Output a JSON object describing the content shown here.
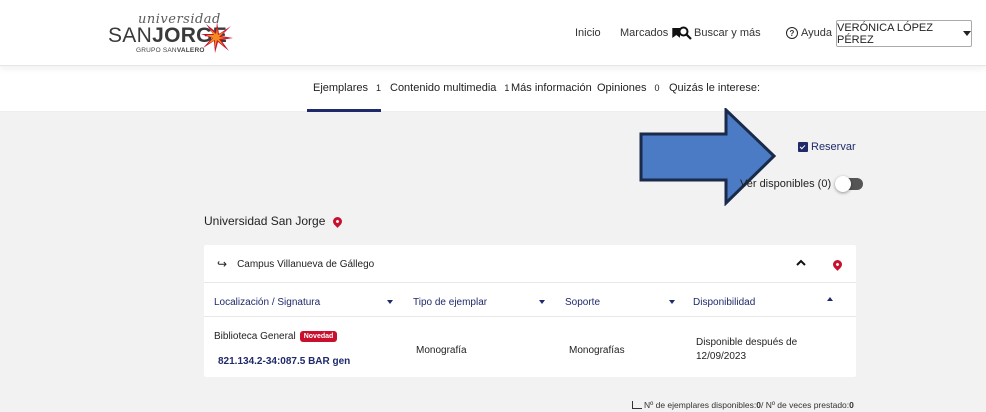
{
  "logo": {
    "top": "universidad",
    "san": "SAN",
    "jorge": "JORGE",
    "grupo_a": "GRUPO SAN",
    "grupo_b": "VALERO"
  },
  "nav": {
    "inicio": "Inicio",
    "marcados": "Marcados",
    "buscar": "Buscar y más",
    "ayuda": "Ayuda",
    "user": "VERÓNICA LÓPEZ PÉREZ"
  },
  "tabs": [
    {
      "label": "Ejemplares",
      "count": "1"
    },
    {
      "label": "Contenido multimedia",
      "count": "1"
    },
    {
      "label": "Más información",
      "count": ""
    },
    {
      "label": "Opiniones",
      "count": "0"
    },
    {
      "label": "Quizás le interese:",
      "count": ""
    }
  ],
  "actions": {
    "reservar": "Reservar",
    "ver_disponibles": "Ver disponibles (0)"
  },
  "library": "Universidad San Jorge",
  "campus": "Campus Villanueva de Gállego",
  "table": {
    "headers": [
      "Localización / Signatura",
      "Tipo de ejemplar",
      "Soporte",
      "Disponibilidad"
    ],
    "row": {
      "location": "Biblioteca General",
      "badge": "Novedad",
      "signature": "821.134.2-34:087.5 BAR gen",
      "tipo": "Monografía",
      "soporte": "Monografías",
      "disponibilidad_1": "Disponible después de",
      "disponibilidad_2": "12/09/2023"
    }
  },
  "stats": {
    "label_a": "Nº de ejemplares disponibles: ",
    "value_a": "0",
    "label_b": " / Nº de veces prestado: ",
    "value_b": "0"
  },
  "colors": {
    "accent": "#1f2a6b",
    "brand_red": "#c8102e",
    "arrow_fill": "#4a7bc4",
    "arrow_stroke": "#1a2a4a"
  }
}
